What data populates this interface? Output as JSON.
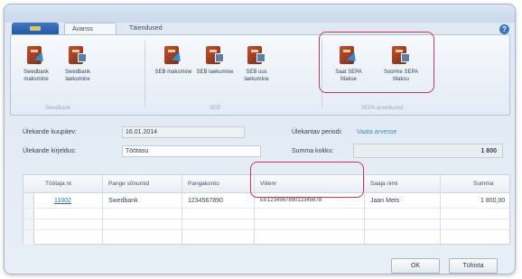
{
  "window": {
    "title": ""
  },
  "ribbon": {
    "tabs": [
      "Avanss",
      "Täiendused"
    ],
    "groups": [
      {
        "label": "Swedbank",
        "buttons": [
          {
            "label": "Swedbank maksmine",
            "icon": "bank-send-icon"
          },
          {
            "label": "Swedbank laekumine",
            "icon": "bank-receive-icon"
          }
        ]
      },
      {
        "label": "SEB",
        "buttons": [
          {
            "label": "SEB maksmine",
            "icon": "bank-send-icon"
          },
          {
            "label": "SEB laekumine",
            "icon": "bank-receive-icon"
          },
          {
            "label": "SEB uus laekumine",
            "icon": "bank-receive-icon"
          }
        ]
      },
      {
        "label": "SEPA arveldused",
        "buttons": [
          {
            "label": "Saat SEPA Makse",
            "icon": "sepa-send-icon"
          },
          {
            "label": "Soorme SEPA Maksu",
            "icon": "sepa-receive-icon"
          }
        ]
      }
    ]
  },
  "form": {
    "date_label": "Ülekande kuupäev:",
    "date_value": "16.01.2014",
    "description_label": "Ülekande kirjeldus:",
    "description_value": "Töötasu",
    "amount_label": "Ülekantav periodi:",
    "amount_link": "Vaata arvesse",
    "sum_label": "Summa kokku:",
    "sum_value": "1 800"
  },
  "grid": {
    "columns": [
      "Töötaja nr.",
      "Pange sõnumid",
      "Pangakonto",
      "Viitenr",
      "Saaja nimi",
      "Summa"
    ],
    "rows": [
      [
        "11002",
        "Swedbank",
        "1234567890",
        "EE123456789012345678",
        "Jaan Mets",
        "1 800,00"
      ]
    ]
  },
  "buttons": {
    "ok": "OK",
    "cancel": "Tühista"
  }
}
